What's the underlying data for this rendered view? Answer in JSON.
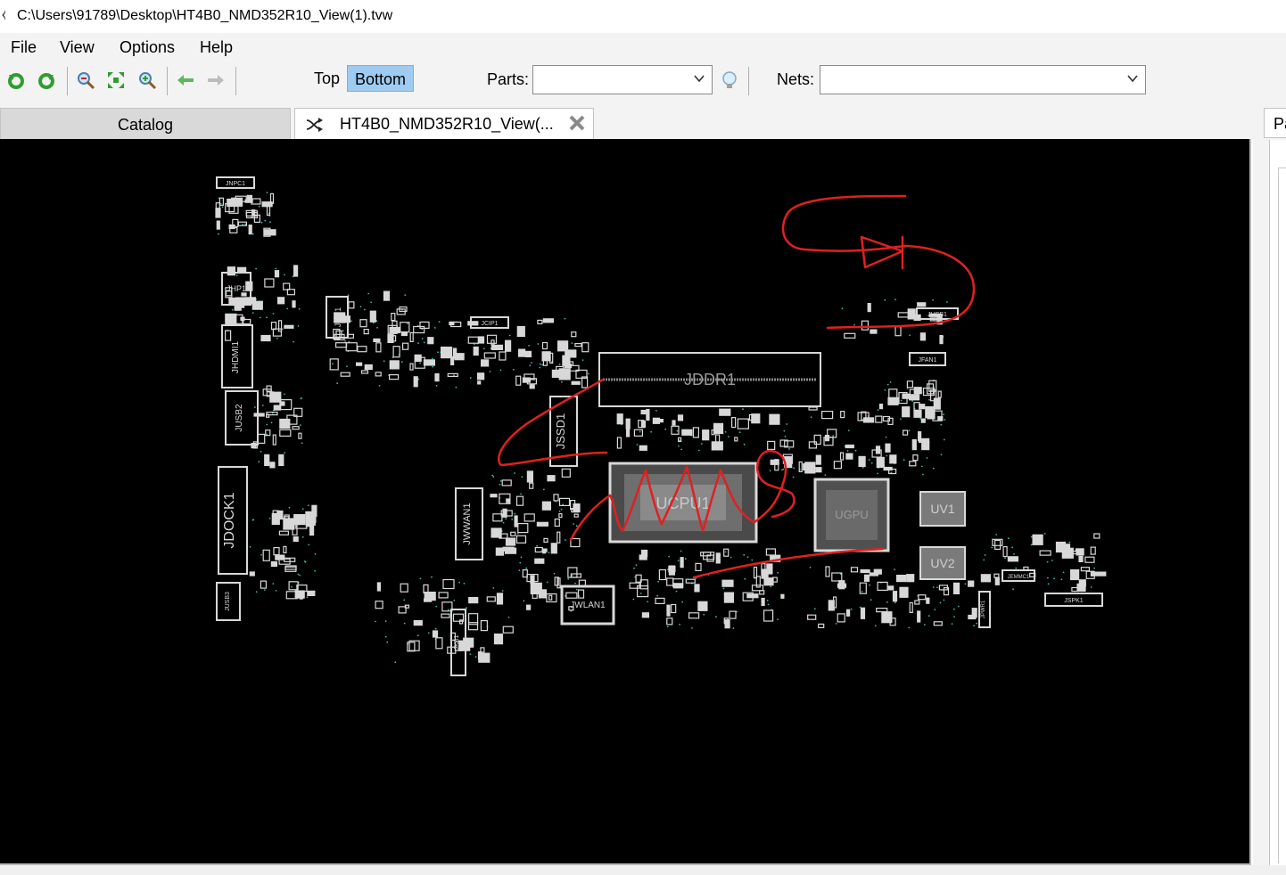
{
  "window": {
    "title": "C:\\Users\\91789\\Desktop\\HT4B0_NMD352R10_View(1).tvw",
    "icon": "boardview-app-icon"
  },
  "menu": {
    "items": [
      "File",
      "View",
      "Options",
      "Help"
    ]
  },
  "toolbar": {
    "icons": [
      "refresh-green-icon",
      "redo-green-icon",
      "zoom-out-icon",
      "fit-view-icon",
      "zoom-in-icon",
      "back-arrow-icon",
      "forward-arrow-icon"
    ],
    "layer_top": "Top",
    "layer_bottom": "Bottom",
    "active_layer": "Bottom",
    "parts_label": "Parts:",
    "parts_value": "",
    "nets_label": "Nets:",
    "nets_value": "",
    "hint_icon": "lightbulb-icon"
  },
  "tabs": {
    "catalog": "Catalog",
    "file": "HT4B0_NMD352R10_View(...",
    "active": "file"
  },
  "right_panel": {
    "tab_label": "Pa"
  },
  "board": {
    "background": "#000000",
    "component_color": "#d8d8d8",
    "pin_color": "#3fb8b0",
    "annotation_color": "#e02020",
    "labels": {
      "jnpc1": "JNPC1",
      "jhp1": "JHP1",
      "jdc1": "JDC1",
      "jhdmi1": "JHDMI1",
      "jusb2": "JUSB2",
      "jdock1": "JDOCK1",
      "jusb3": "JUSB3",
      "jddr1": "JDDR1",
      "jssd1": "JSSD1",
      "jwwan1": "JWWAN1",
      "ucpu1": "UCPU1",
      "ugpu": "UGPU",
      "uv1": "UV1",
      "uv2": "UV2",
      "jusb1": "JUSB1",
      "jfan1": "JFAN1",
      "jwlan1": "JWLAN1",
      "jcip1": "JCIP1",
      "jkb1": "JKB1",
      "jspk1": "JSPK1",
      "jpwr1": "JPWR1",
      "jemmc1": "JEMMC1"
    }
  }
}
